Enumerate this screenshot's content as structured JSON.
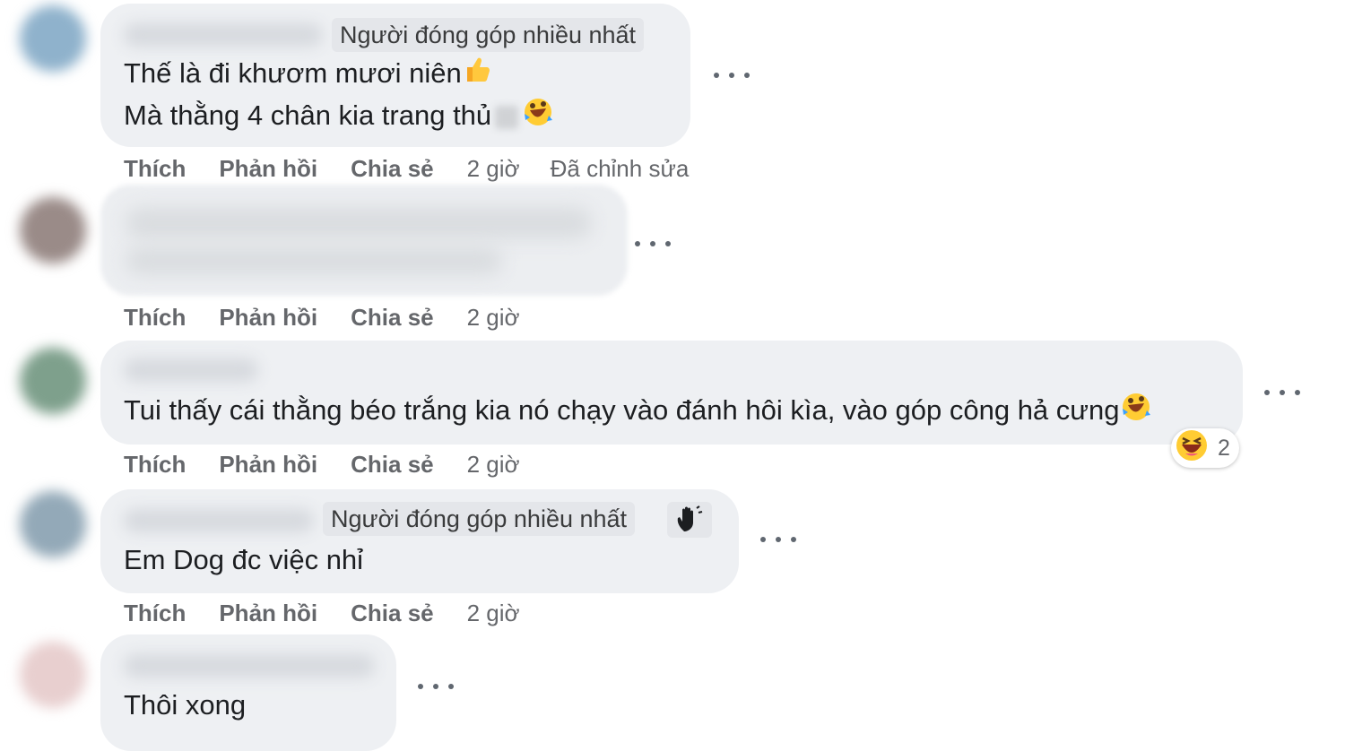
{
  "comments": [
    {
      "badge": "Người đóng góp nhiều nhất",
      "lines": [
        "Thế là đi khươm mươi niên",
        "Mà thằng 4 chân kia trang thủ"
      ],
      "actions": {
        "like": "Thích",
        "reply": "Phản hồi",
        "share": "Chia sẻ",
        "time": "2 giờ",
        "edited": "Đã chỉnh sửa"
      },
      "avatar_color": "#8fb2cc"
    },
    {
      "actions": {
        "like": "Thích",
        "reply": "Phản hồi",
        "share": "Chia sẻ",
        "time": "2 giờ"
      },
      "avatar_color": "#9a8b88"
    },
    {
      "lines": [
        "Tui thấy cái thằng béo trắng kia nó chạy vào đánh hôi kìa, vào góp công hả cưng"
      ],
      "reaction": {
        "count": "2",
        "icon": "laughing-emoji"
      },
      "actions": {
        "like": "Thích",
        "reply": "Phản hồi",
        "share": "Chia sẻ",
        "time": "2 giờ"
      },
      "avatar_color": "#7ea08c"
    },
    {
      "badge": "Người đóng góp nhiều nhất",
      "lines": [
        "Em Dog đc việc nhỉ"
      ],
      "actions": {
        "like": "Thích",
        "reply": "Phản hồi",
        "share": "Chia sẻ",
        "time": "2 giờ"
      },
      "avatar_color": "#93a9b8"
    },
    {
      "lines": [
        "Thôi xong"
      ],
      "avatar_color": "#e8cfcf"
    }
  ],
  "colors": {
    "bubble": "#eef0f3",
    "badge": "#e4e6ea",
    "meta": "#65676b",
    "text": "#1c1e21"
  }
}
